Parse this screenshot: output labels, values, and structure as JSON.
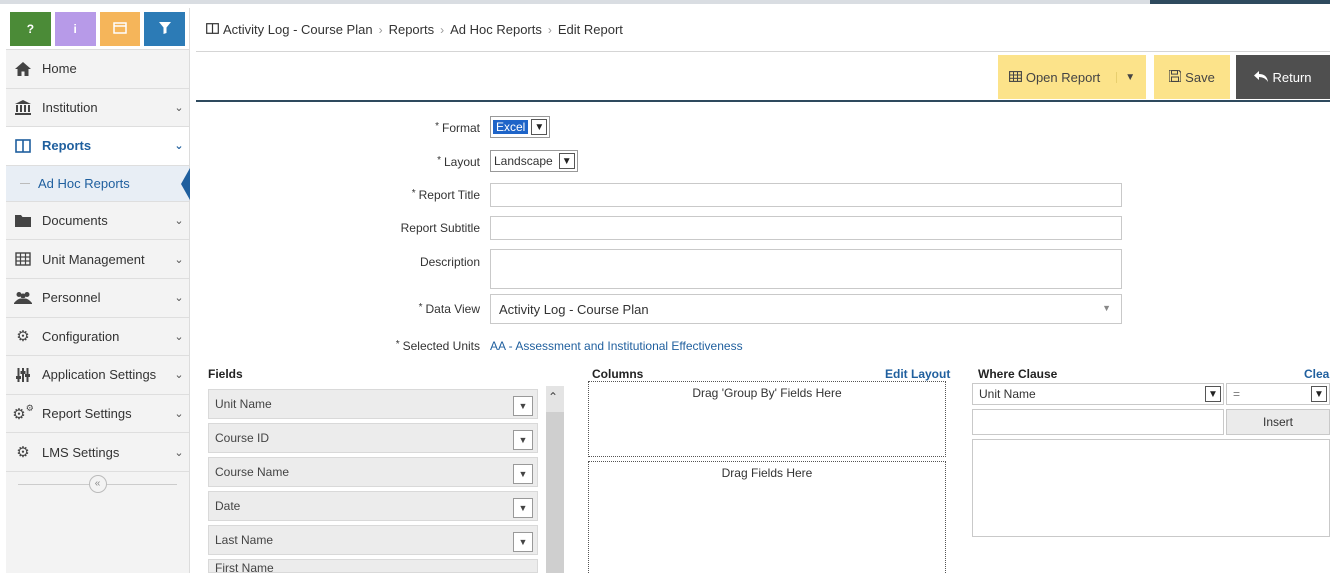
{
  "quick_buttons": [
    {
      "label": "?",
      "icon": "help-icon",
      "color": "#4b8b37"
    },
    {
      "label": "i",
      "icon": "info-icon",
      "color": "#b79ae8"
    },
    {
      "label": "",
      "icon": "window-icon",
      "color": "#f5b55a"
    },
    {
      "label": "",
      "icon": "filter-icon",
      "color": "#2c7bb6"
    }
  ],
  "nav": {
    "home": "Home",
    "institution": "Institution",
    "reports": "Reports",
    "ad_hoc_reports": "Ad Hoc Reports",
    "documents": "Documents",
    "unit_management": "Unit Management",
    "personnel": "Personnel",
    "configuration": "Configuration",
    "application_settings": "Application Settings",
    "report_settings": "Report Settings",
    "lms_settings": "LMS Settings"
  },
  "breadcrumb": [
    "Activity Log - Course Plan",
    "Reports",
    "Ad Hoc Reports",
    "Edit Report"
  ],
  "toolbar": {
    "open_report": "Open Report",
    "save": "Save",
    "return": "Return"
  },
  "form": {
    "required_mark": "*",
    "format_label": "Format",
    "format_value": "Excel",
    "layout_label": "Layout",
    "layout_value": "Landscape",
    "report_title_label": "Report Title",
    "report_subtitle_label": "Report Subtitle",
    "description_label": "Description",
    "data_view_label": "Data View",
    "data_view_value": "Activity Log - Course Plan",
    "selected_units_label": "Selected Units",
    "selected_units_value": "AA - Assessment and Institutional Effectiveness"
  },
  "fields_panel": {
    "title": "Fields",
    "items": [
      "Unit Name",
      "Course ID",
      "Course Name",
      "Date",
      "Last Name",
      "First Name"
    ]
  },
  "columns_panel": {
    "title": "Columns",
    "edit_layout": "Edit Layout",
    "group_by_hint": "Drag 'Group By' Fields Here",
    "fields_hint": "Drag Fields Here"
  },
  "where_panel": {
    "title": "Where Clause",
    "clear": "Clea",
    "field_value": "Unit Name",
    "operator_value": "=",
    "insert": "Insert"
  },
  "colors": {
    "accent": "#1f5f9e",
    "toolbar_yellow": "#fce38a",
    "return_dark": "#4f4f4f"
  }
}
